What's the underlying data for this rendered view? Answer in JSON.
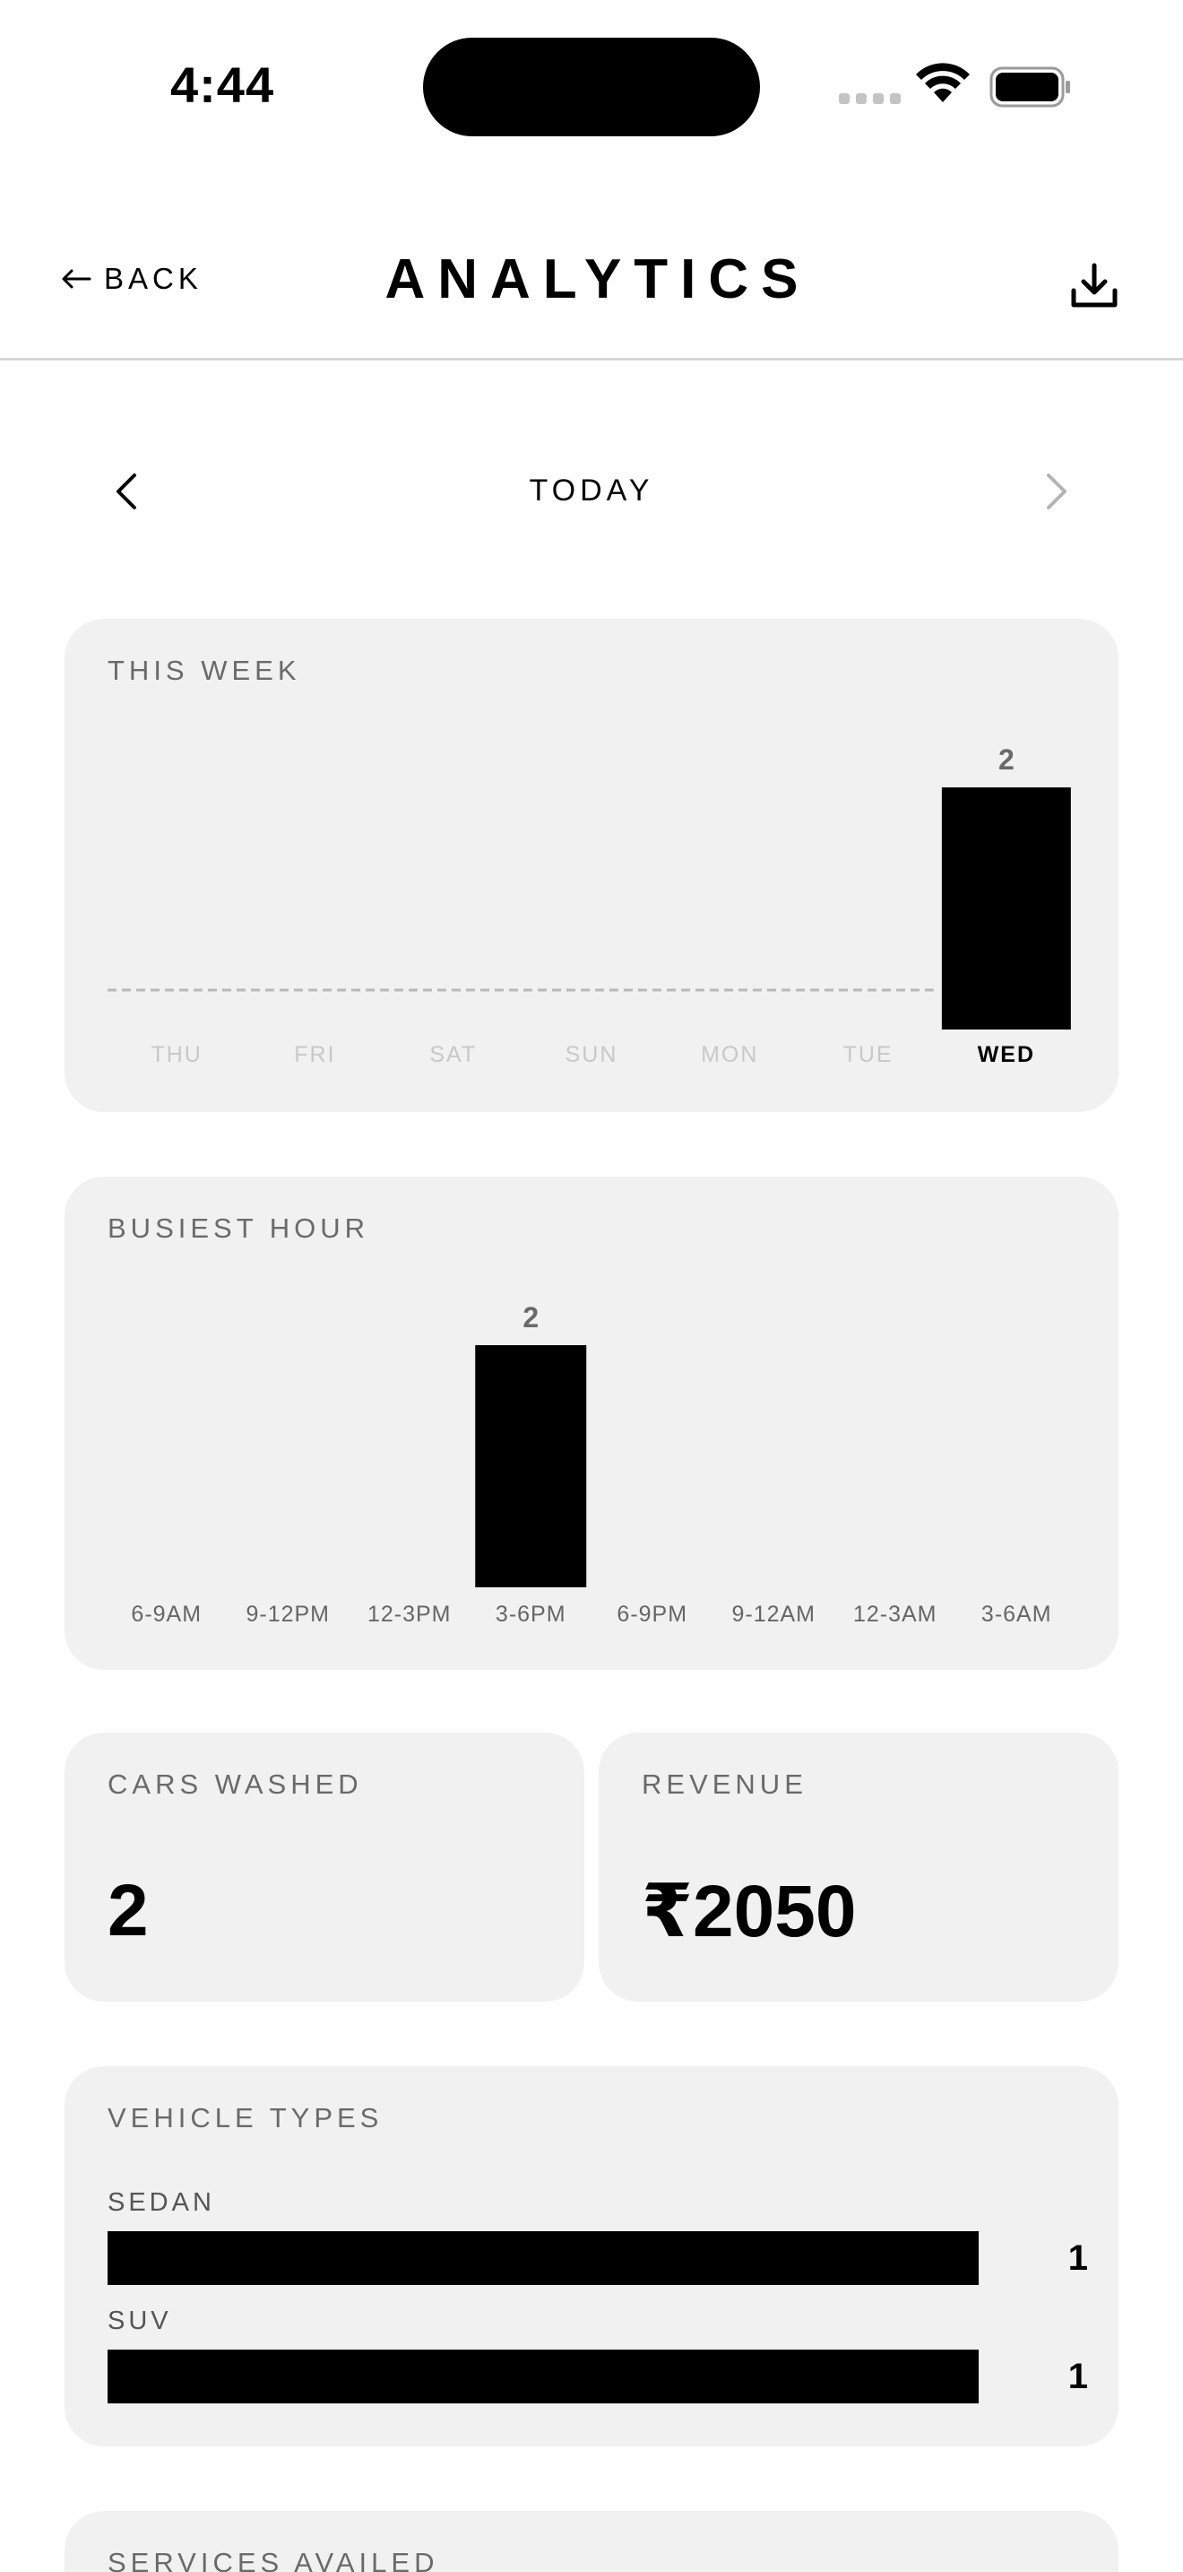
{
  "status_bar": {
    "time": "4:44"
  },
  "header": {
    "back_label": "BACK",
    "title": "ANALYTICS",
    "download_icon": "download-icon"
  },
  "date_nav": {
    "label": "TODAY"
  },
  "week": {
    "title": "THIS WEEK",
    "chart_data": {
      "type": "bar",
      "categories": [
        "THU",
        "FRI",
        "SAT",
        "SUN",
        "MON",
        "TUE",
        "WED"
      ],
      "values": [
        0,
        0,
        0,
        0,
        0,
        0,
        2
      ],
      "highlight": "WED"
    }
  },
  "busiest_hour": {
    "title": "BUSIEST HOUR",
    "chart_data": {
      "type": "bar",
      "categories": [
        "6-9AM",
        "9-12PM",
        "12-3PM",
        "3-6PM",
        "6-9PM",
        "9-12AM",
        "12-3AM",
        "3-6AM"
      ],
      "values": [
        0,
        0,
        0,
        2,
        0,
        0,
        0,
        0
      ]
    }
  },
  "cars_washed": {
    "label": "CARS WASHED",
    "value": "2"
  },
  "revenue": {
    "label": "REVENUE",
    "value": "₹2050"
  },
  "vehicle_types": {
    "title": "VEHICLE TYPES",
    "items": [
      {
        "label": "SEDAN",
        "count": "1",
        "fraction": 1
      },
      {
        "label": "SUV",
        "count": "1",
        "fraction": 1
      }
    ]
  },
  "services": {
    "title": "SERVICES AVAILED"
  },
  "colors": {
    "bar": "#000000",
    "card_bg": "#f1f1f1",
    "muted_text": "#6a6a6a",
    "inactive_label": "#c8c8c8"
  }
}
